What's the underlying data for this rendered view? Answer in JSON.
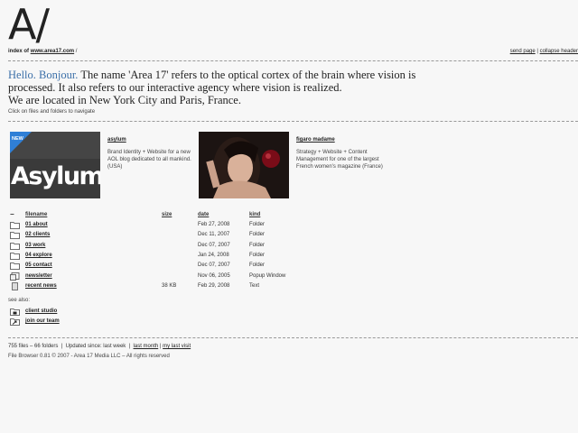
{
  "header": {
    "logo": "A/",
    "index_prefix": "index of ",
    "index_link": "www.area17.com",
    "index_suffix": " /",
    "send_page": "send page",
    "separator": " | ",
    "collapse_header": "collapse header"
  },
  "intro": {
    "hello": "Hello. Bonjour.",
    "line1": " The name 'Area 17' refers to the optical cortex of the brain where vision is processed. It also refers to our interactive agency where vision is realized.",
    "line2": "We are located in New York City and Paris, France.",
    "hint": "Click on files and folders to navigate"
  },
  "projects": [
    {
      "title": "asylum",
      "badge": "NEW",
      "thumb_text": "Asylum",
      "description": "Brand Identity + Website for a new AOL blog dedicated to all mankind. (USA)"
    },
    {
      "title": "figaro madame",
      "description": "Strategy + Website + Content Management for one of the largest French women's magazine (France)"
    }
  ],
  "file_table": {
    "headers": {
      "icon": "−",
      "name": "filename",
      "size": "size",
      "date": "date",
      "kind": "kind"
    },
    "rows": [
      {
        "icon": "folder-icon",
        "name": "01 about",
        "size": "",
        "date": "Feb 27, 2008",
        "kind": "Folder"
      },
      {
        "icon": "folder-icon",
        "name": "02 clients",
        "size": "",
        "date": "Dec 11, 2007",
        "kind": "Folder"
      },
      {
        "icon": "folder-icon",
        "name": "03 work",
        "size": "",
        "date": "Dec 07, 2007",
        "kind": "Folder"
      },
      {
        "icon": "folder-icon",
        "name": "04 explore",
        "size": "",
        "date": "Jan 24, 2008",
        "kind": "Folder"
      },
      {
        "icon": "folder-icon",
        "name": "05 contact",
        "size": "",
        "date": "Dec 07, 2007",
        "kind": "Folder"
      },
      {
        "icon": "popup-window-icon",
        "name": "newsletter",
        "size": "",
        "date": "Nov 06, 2005",
        "kind": "Popup Window"
      },
      {
        "icon": "text-file-icon",
        "name": "recent news",
        "size": "38 KB",
        "date": "Feb 29, 2008",
        "kind": "Text"
      }
    ]
  },
  "see_also": {
    "label": "see also:",
    "links": [
      {
        "icon": "lock-folder-icon",
        "name": "client studio"
      },
      {
        "icon": "shortcut-folder-icon",
        "name": "join our team"
      }
    ]
  },
  "footer": {
    "stats": "755 files – 66 folders",
    "sep1": "  |  Updated since: last week  |  ",
    "last_month": "last month",
    "sep2": " | ",
    "last_visit": "my last visit",
    "copyright": "File Browser 0.81 © 2007 - Area 17 Media LLC – All rights reserved"
  },
  "colors": {
    "accent": "#3b6fa8",
    "background": "#f7f7f7",
    "text": "#222222"
  }
}
